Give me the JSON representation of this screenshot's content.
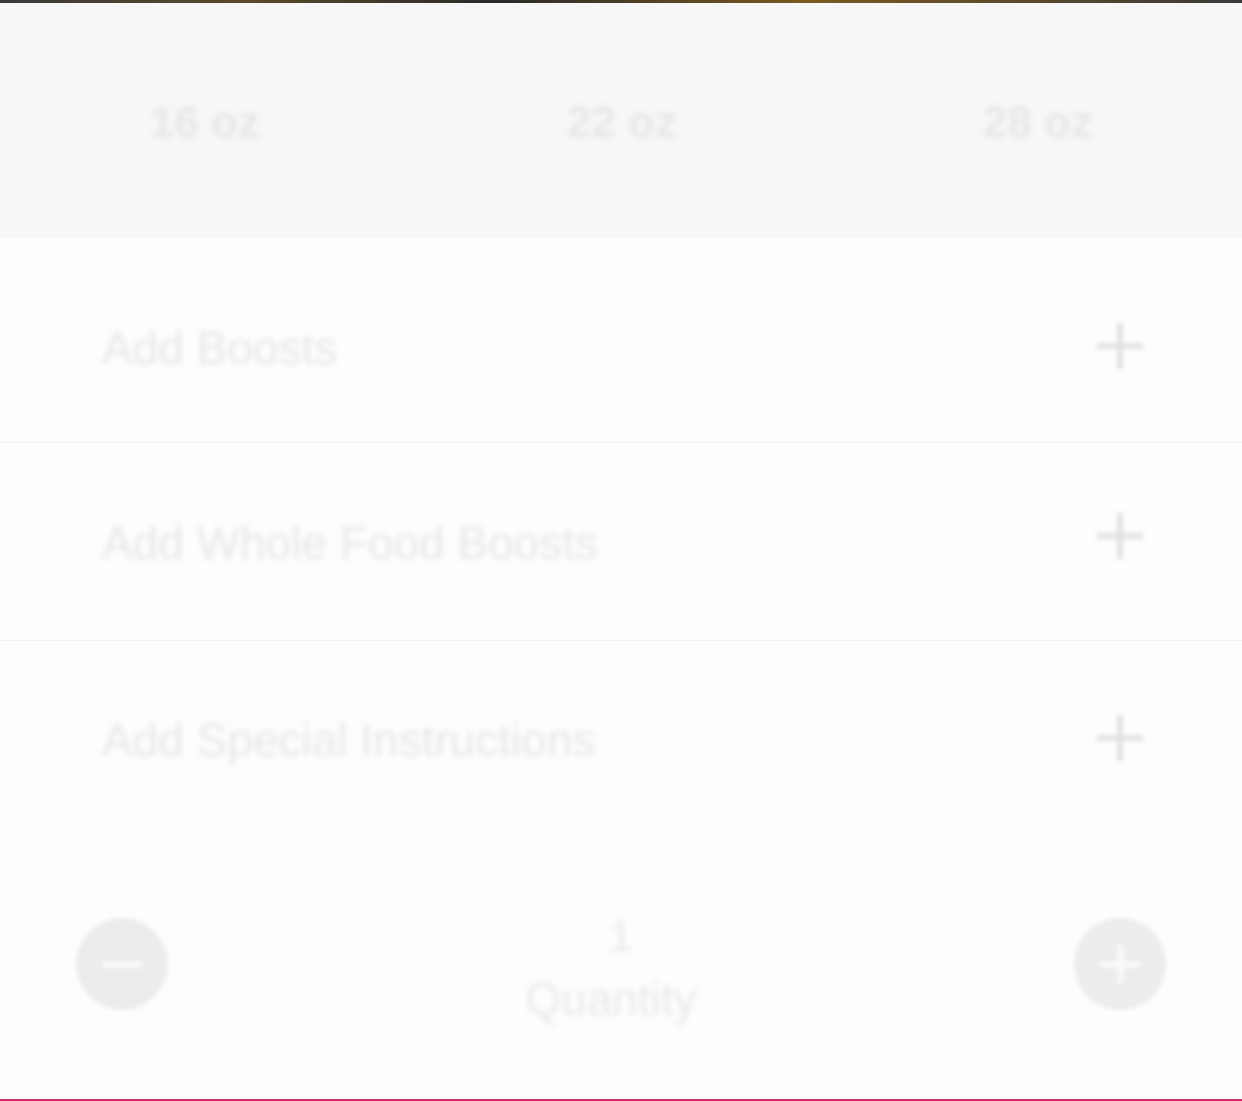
{
  "sizes": {
    "options": [
      "16 oz",
      "22 oz",
      "28 oz"
    ]
  },
  "addons": {
    "boosts_label": "Add Boosts",
    "whole_food_label": "Add Whole Food Boosts",
    "special_label": "Add Special Instructions"
  },
  "quantity": {
    "value": "1",
    "label": "Quantity"
  },
  "colors": {
    "accent_bottom": "#cf2f6f"
  }
}
